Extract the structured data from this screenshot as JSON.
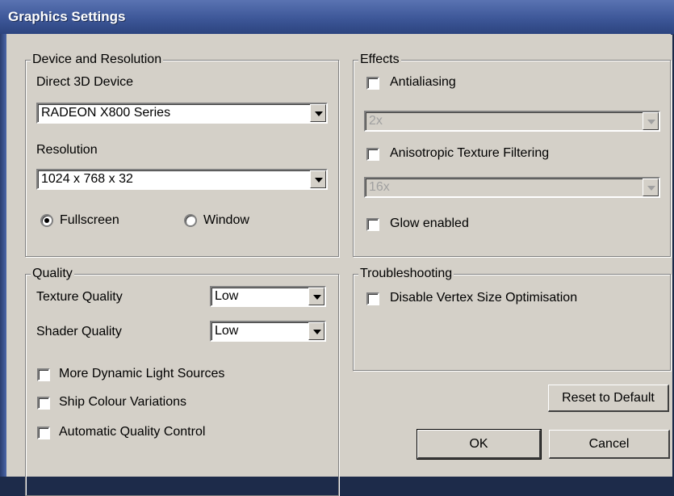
{
  "window": {
    "title": "Graphics Settings"
  },
  "device_group": {
    "legend": "Device and Resolution",
    "device_label": "Direct 3D Device",
    "device_value": "RADEON X800 Series",
    "resolution_label": "Resolution",
    "resolution_value": "1024 x 768 x 32",
    "fullscreen_label": "Fullscreen",
    "window_label": "Window",
    "selected_mode": "Fullscreen"
  },
  "effects_group": {
    "legend": "Effects",
    "antialiasing_label": "Antialiasing",
    "antialiasing_checked": false,
    "antialiasing_value": "2x",
    "anisotropic_label": "Anisotropic Texture Filtering",
    "anisotropic_checked": false,
    "anisotropic_value": "16x",
    "glow_label": "Glow enabled",
    "glow_checked": false
  },
  "quality_group": {
    "legend": "Quality",
    "texture_label": "Texture Quality",
    "texture_value": "Low",
    "shader_label": "Shader Quality",
    "shader_value": "Low",
    "dynamic_lights_label": "More Dynamic Light Sources",
    "ship_colour_label": "Ship Colour Variations",
    "auto_quality_label": "Automatic Quality Control"
  },
  "troubleshooting_group": {
    "legend": "Troubleshooting",
    "vertex_label": "Disable Vertex Size Optimisation"
  },
  "buttons": {
    "reset_label": "Reset to Default",
    "ok_label": "OK",
    "cancel_label": "Cancel"
  },
  "icons": {
    "dropdown": "chevron-down-icon",
    "checkbox": "checkbox-unchecked-icon",
    "radio_selected": "radio-selected-icon",
    "radio_unselected": "radio-unselected-icon"
  },
  "colors": {
    "dialog_face": "#d4d0c8",
    "title_bar": "#3d5798",
    "title_text": "#ffffff",
    "disabled_text": "#a0a0a0"
  }
}
